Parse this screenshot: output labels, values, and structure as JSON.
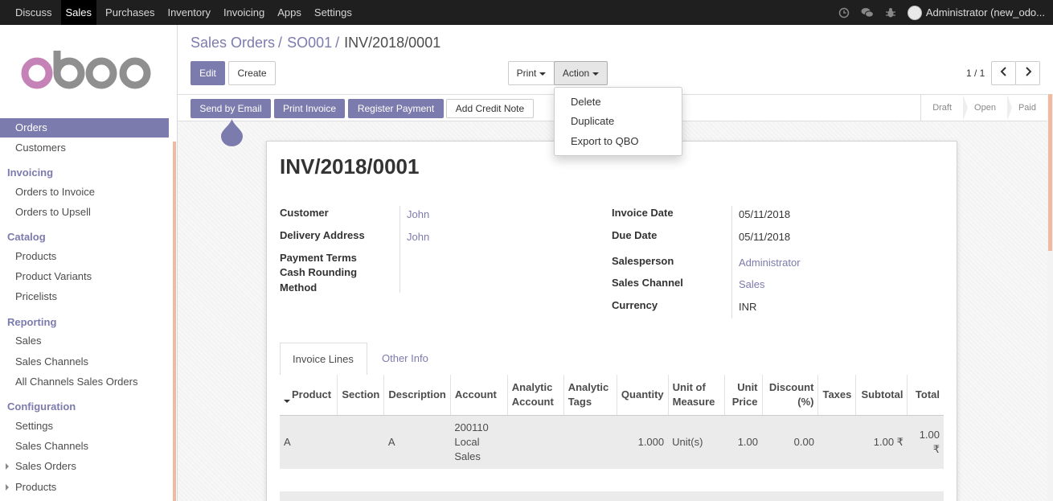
{
  "topbar": {
    "menu": [
      "Discuss",
      "Sales",
      "Purchases",
      "Inventory",
      "Invoicing",
      "Apps",
      "Settings"
    ],
    "active_menu": "Sales",
    "user": "Administrator (new_odo..."
  },
  "sidebar": {
    "items": [
      {
        "type": "item",
        "label": "Orders",
        "active": true
      },
      {
        "type": "item",
        "label": "Customers"
      },
      {
        "type": "header",
        "label": "Invoicing"
      },
      {
        "type": "item",
        "label": "Orders to Invoice"
      },
      {
        "type": "item",
        "label": "Orders to Upsell"
      },
      {
        "type": "header",
        "label": "Catalog"
      },
      {
        "type": "item",
        "label": "Products"
      },
      {
        "type": "item",
        "label": "Product Variants"
      },
      {
        "type": "item",
        "label": "Pricelists"
      },
      {
        "type": "header",
        "label": "Reporting"
      },
      {
        "type": "item",
        "label": "Sales"
      },
      {
        "type": "item",
        "label": "Sales Channels"
      },
      {
        "type": "item",
        "label": "All Channels Sales Orders"
      },
      {
        "type": "header",
        "label": "Configuration"
      },
      {
        "type": "item",
        "label": "Settings"
      },
      {
        "type": "item",
        "label": "Sales Channels"
      },
      {
        "type": "item",
        "label": "Sales Orders",
        "expandable": true
      },
      {
        "type": "item",
        "label": "Products",
        "expandable": true
      }
    ]
  },
  "breadcrumb": {
    "items": [
      "Sales Orders",
      "SO001"
    ],
    "current": "INV/2018/0001"
  },
  "buttons": {
    "edit": "Edit",
    "create": "Create",
    "print": "Print",
    "action": "Action"
  },
  "pager": "1 / 1",
  "statusbar": {
    "send_by_email": "Send by Email",
    "print_invoice": "Print Invoice",
    "register_payment": "Register Payment",
    "add_credit_note": "Add Credit Note",
    "stages": [
      "Draft",
      "Open",
      "Paid"
    ]
  },
  "action_menu": [
    "Delete",
    "Duplicate",
    "Export to QBO"
  ],
  "invoice": {
    "number": "INV/2018/0001",
    "customer_label": "Customer",
    "customer": "John",
    "delivery_label": "Delivery Address",
    "delivery": "John",
    "payment_terms_label": "Payment Terms",
    "cash_rounding_label_1": "Cash Rounding",
    "cash_rounding_label_2": "Method",
    "invoice_date_label": "Invoice Date",
    "invoice_date": "05/11/2018",
    "due_date_label": "Due Date",
    "due_date": "05/11/2018",
    "salesperson_label": "Salesperson",
    "salesperson": "Administrator",
    "sales_channel_label": "Sales Channel",
    "sales_channel": "Sales",
    "currency_label": "Currency",
    "currency": "INR"
  },
  "tabs": [
    "Invoice Lines",
    "Other Info"
  ],
  "lines": {
    "headers": {
      "product": "Product",
      "section": "Section",
      "description": "Description",
      "account": "Account",
      "analytic_account_1": "Analytic",
      "analytic_account_2": "Account",
      "analytic_tags_1": "Analytic",
      "analytic_tags_2": "Tags",
      "quantity": "Quantity",
      "uom_1": "Unit of",
      "uom_2": "Measure",
      "unit_price_1": "Unit",
      "unit_price_2": "Price",
      "discount_1": "Discount",
      "discount_2": "(%)",
      "taxes": "Taxes",
      "subtotal": "Subtotal",
      "total": "Total"
    },
    "rows": [
      {
        "product": "A",
        "section": "",
        "description": "A",
        "account_1": "200110",
        "account_2": "Local",
        "account_3": "Sales",
        "analytic_account": "",
        "analytic_tags": "",
        "quantity": "1.000",
        "uom": "Unit(s)",
        "unit_price": "1.00",
        "discount": "0.00",
        "taxes": "",
        "subtotal": "1.00 ₹",
        "total": "1.00 ₹"
      }
    ]
  },
  "colors": {
    "brand": "#7c7bad",
    "accent": "#f0b9a1"
  }
}
